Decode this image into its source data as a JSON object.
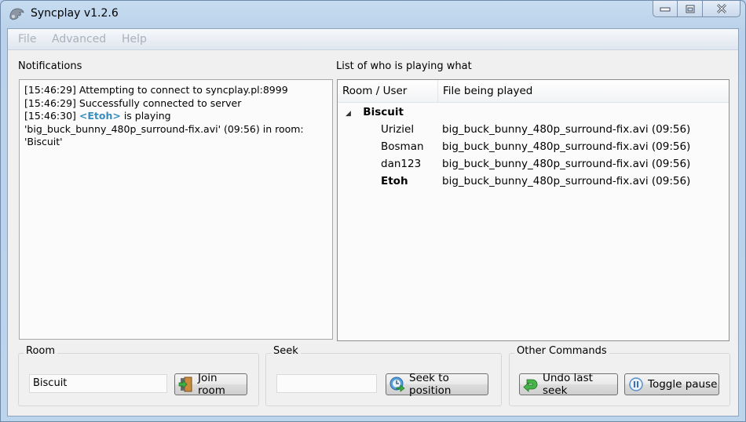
{
  "window": {
    "title": "Syncplay v1.2.6",
    "caption_buttons": [
      "minimize-icon",
      "maximize-icon",
      "close-icon"
    ]
  },
  "menu": {
    "items": [
      "File",
      "Advanced",
      "Help"
    ]
  },
  "notifications": {
    "label": "Notifications",
    "lines": [
      {
        "time": "[15:46:29]",
        "text": " Attempting to connect to syncplay.pl:8999"
      },
      {
        "time": "[15:46:29]",
        "text": " Successfully connected to server"
      },
      {
        "time": "[15:46:30]",
        "user": "<Etoh>",
        "text": " is playing"
      },
      {
        "text": "'big_buck_bunny_480p_surround-fix.avi' (09:56) in room:"
      },
      {
        "text": "'Biscuit'"
      }
    ],
    "user_color": "#3a8dbf"
  },
  "playlist": {
    "label": "List of who is playing what",
    "columns": [
      "Room / User",
      "File being played"
    ],
    "room": {
      "name": "Biscuit",
      "expanded": true
    },
    "users": [
      {
        "name": "Uriziel",
        "file": "big_buck_bunny_480p_surround-fix.avi (09:56)",
        "bold": false
      },
      {
        "name": "Bosman",
        "file": "big_buck_bunny_480p_surround-fix.avi (09:56)",
        "bold": false
      },
      {
        "name": "dan123",
        "file": "big_buck_bunny_480p_surround-fix.avi (09:56)",
        "bold": false
      },
      {
        "name": "Etoh",
        "file": "big_buck_bunny_480p_surround-fix.avi (09:56)",
        "bold": true
      }
    ]
  },
  "room_group": {
    "title": "Room",
    "input_value": "Biscuit",
    "join_label": "Join room"
  },
  "seek_group": {
    "title": "Seek",
    "input_value": "",
    "seek_label": "Seek to position"
  },
  "other_group": {
    "title": "Other Commands",
    "undo_label": "Undo last seek",
    "pause_label": "Toggle pause"
  }
}
